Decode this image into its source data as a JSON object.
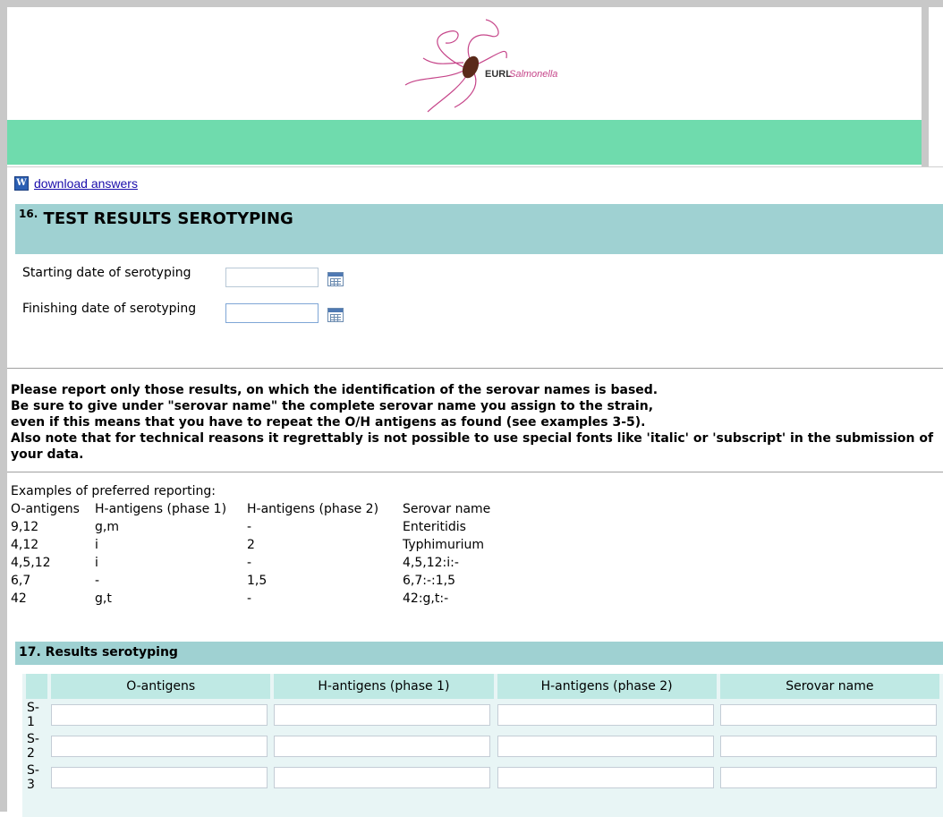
{
  "logo": {
    "brand_bold": "EURL",
    "brand_italic": "Salmonella"
  },
  "download": {
    "icon": "word-icon",
    "label": "download answers"
  },
  "section16": {
    "number": "16.",
    "title": "TEST RESULTS SEROTYPING"
  },
  "dates": {
    "start_label": "Starting date of serotyping",
    "finish_label": "Finishing date of serotyping",
    "start_value": "",
    "finish_value": ""
  },
  "notice": [
    "Please report only those results, on which the identification of the serovar names is based.",
    "Be sure to give under \"serovar name\" the complete serovar name you assign to the strain,",
    "even if this means that you have to repeat the O/H antigens as found (see examples 3-5).",
    "Also note that for technical reasons it regrettably is not possible to use special fonts like 'italic' or 'subscript' in the submission of your data."
  ],
  "examples": {
    "title": "Examples of preferred reporting:",
    "headers": [
      "O-antigens",
      "H-antigens (phase 1)",
      "H-antigens (phase 2)",
      "Serovar name"
    ],
    "rows": [
      [
        "9,12",
        "g,m",
        "-",
        "Enteritidis"
      ],
      [
        "4,12",
        "i",
        "2",
        "Typhimurium"
      ],
      [
        "4,5,12",
        "i",
        "-",
        "4,5,12:i:-"
      ],
      [
        "6,7",
        "-",
        "1,5",
        "6,7:-:1,5"
      ],
      [
        "42",
        "g,t",
        "-",
        "42:g,t:-"
      ]
    ]
  },
  "section17": {
    "title": "17. Results serotyping"
  },
  "results": {
    "headers": [
      "O-antigens",
      "H-antigens (phase 1)",
      "H-antigens (phase 2)",
      "Serovar name"
    ],
    "rows": [
      {
        "label_a": "S-",
        "label_b": "1"
      },
      {
        "label_a": "S-",
        "label_b": "2"
      },
      {
        "label_a": "S-",
        "label_b": "3"
      }
    ]
  },
  "colors": {
    "teal_header": "#9fd1d2",
    "green_band": "#6fdbad",
    "table_header": "#bfe9e4"
  }
}
